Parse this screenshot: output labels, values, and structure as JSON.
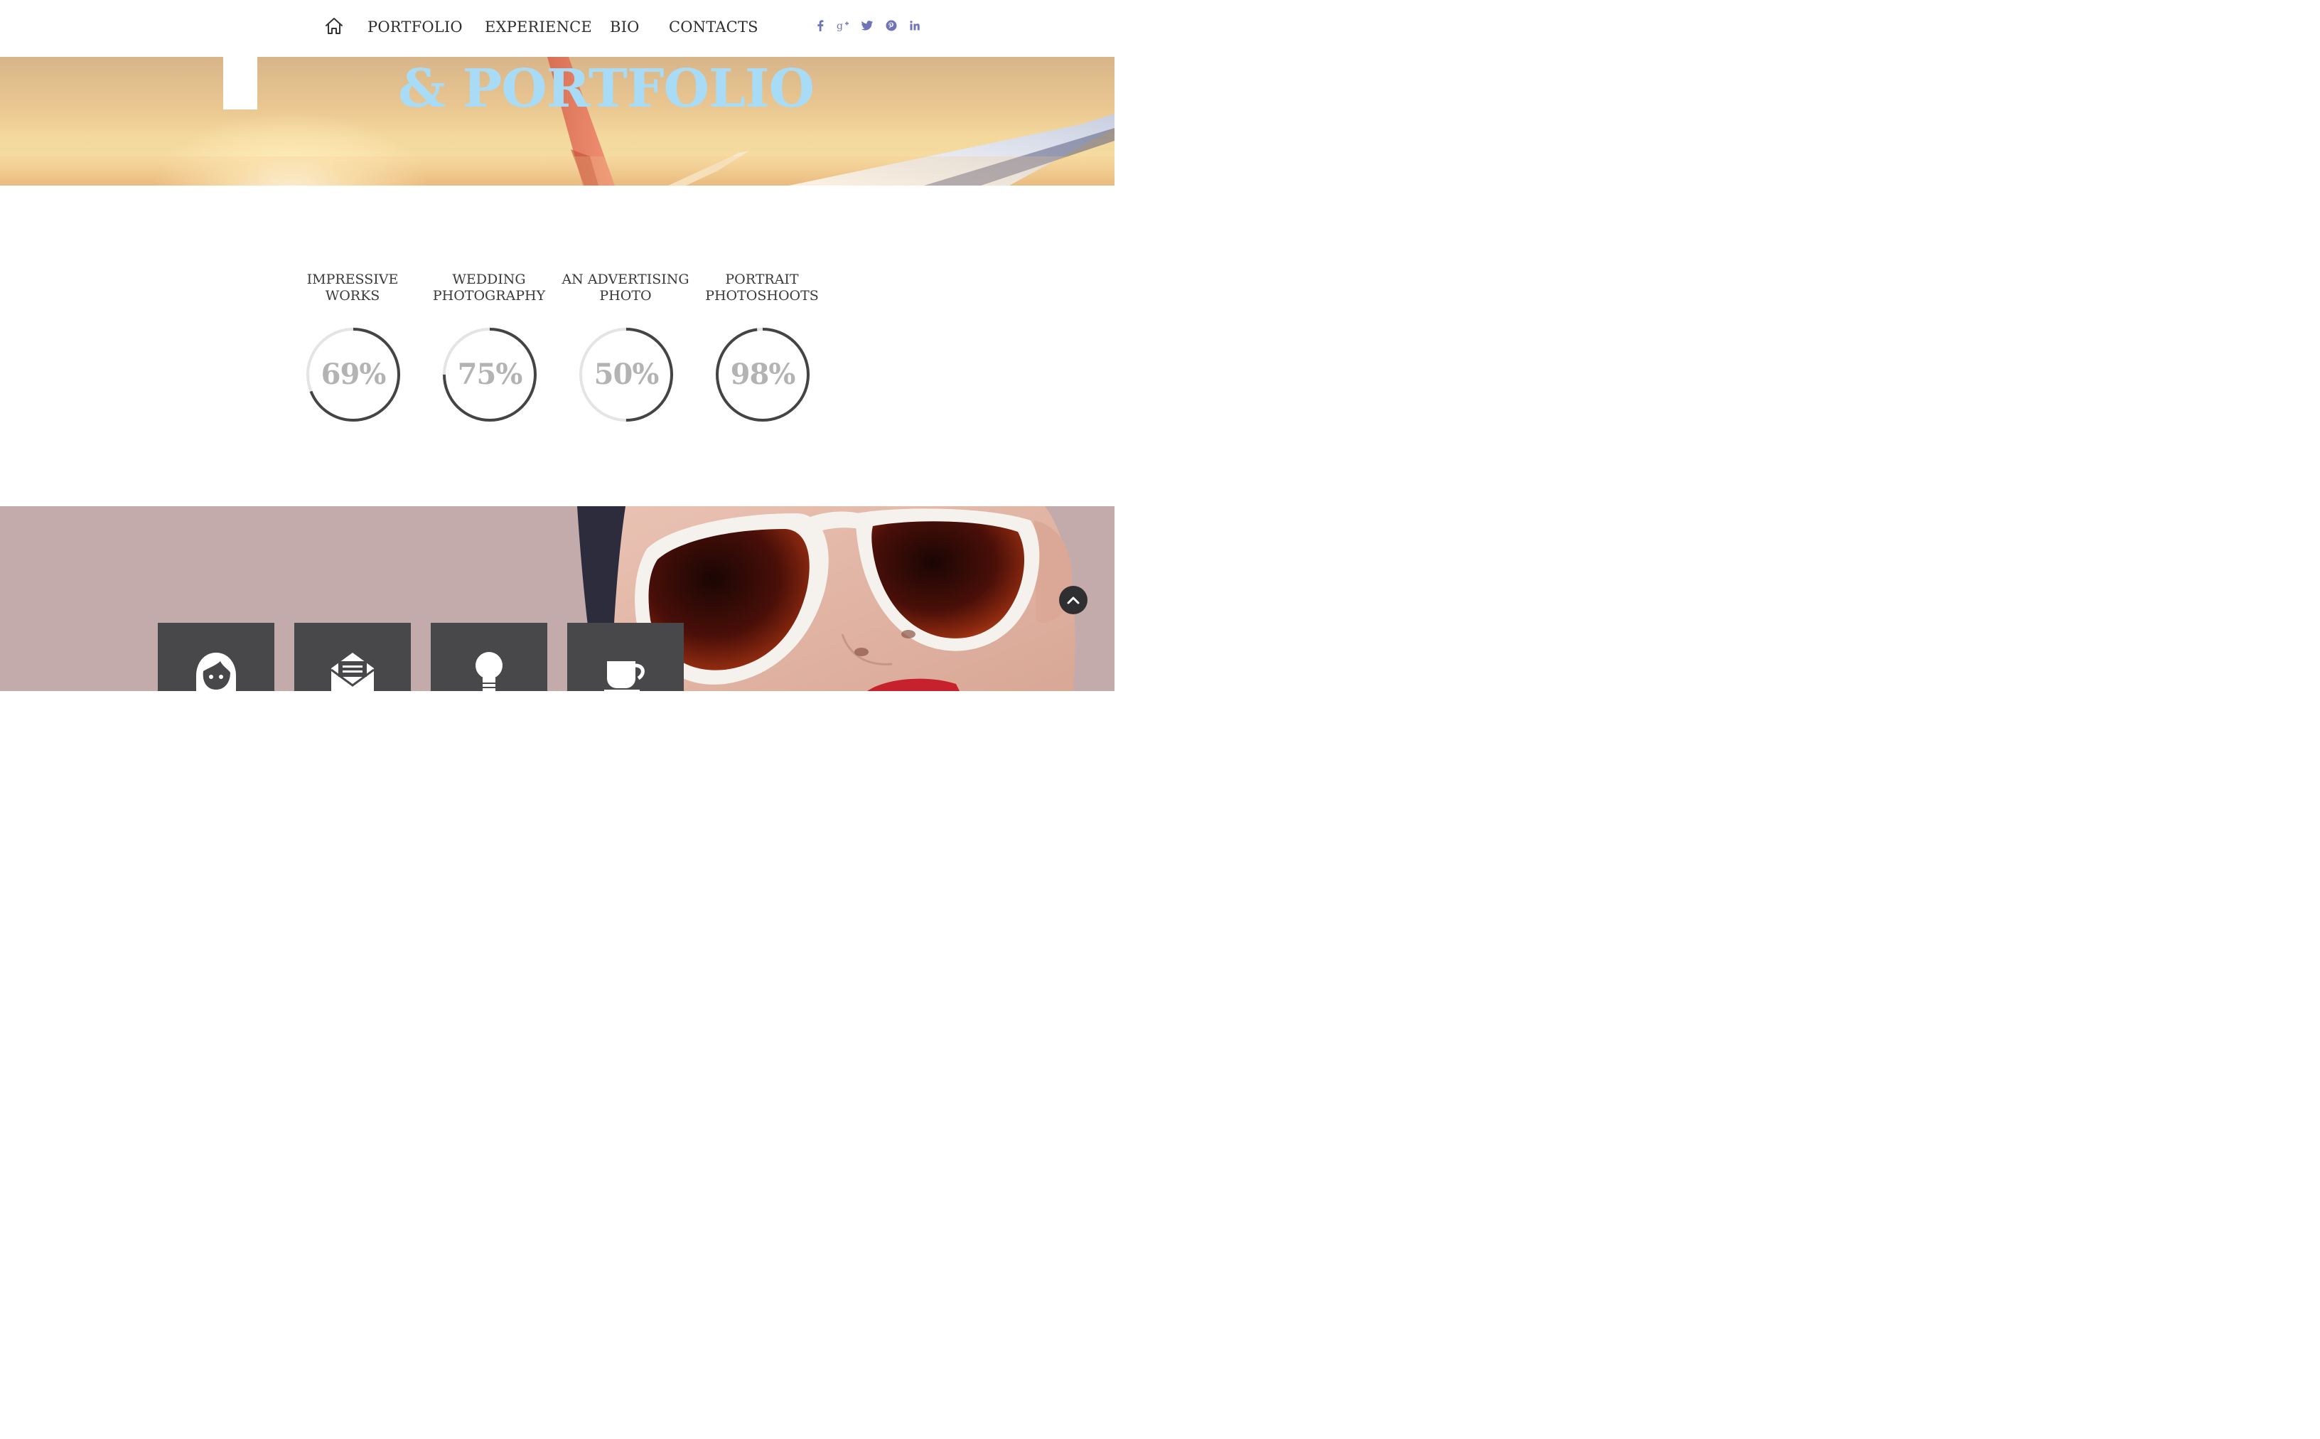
{
  "nav": {
    "home_icon": "home-icon",
    "items": [
      {
        "label": "PORTFOLIO"
      },
      {
        "label": "EXPERIENCE"
      },
      {
        "label": "BIO"
      },
      {
        "label": "CONTACTS"
      }
    ],
    "social": [
      "facebook-icon",
      "google-plus-icon",
      "twitter-icon",
      "pinterest-icon",
      "linkedin-icon"
    ],
    "social_color": "#6f74b8"
  },
  "hero": {
    "title": "& PORTFOLIO",
    "title_color": "#a8dcf6"
  },
  "skills": [
    {
      "label": "IMPRESSIVE WORKS",
      "value_text": "69%",
      "value": 69
    },
    {
      "label": "WEDDING PHOTOGRAPHY",
      "value_text": "75%",
      "value": 75
    },
    {
      "label": "AN ADVERTISING PHOTO",
      "value_text": "50%",
      "value": 50
    },
    {
      "label": "PORTRAIT PHOTOSHOOTS",
      "value_text": "98%",
      "value": 98
    }
  ],
  "ring_colors": {
    "filled": "#444444",
    "track": "#e4e4e4"
  },
  "services": {
    "tiles": [
      "woman-face-icon",
      "open-envelope-icon",
      "light-bulb-icon",
      "coffee-cup-icon"
    ],
    "tile_color": "#48484a"
  },
  "back_to_top_icon": "chevron-up-icon"
}
